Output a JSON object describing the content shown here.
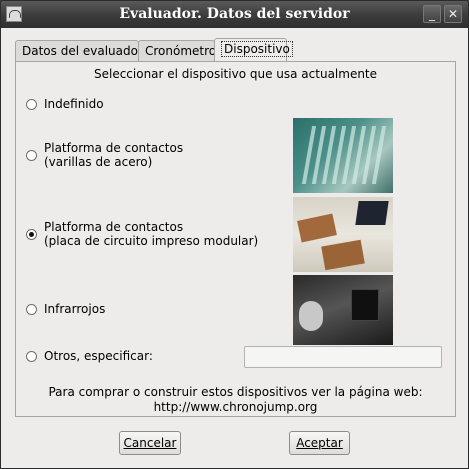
{
  "window": {
    "title": "Evaluador. Datos del servidor",
    "icons": {
      "app": "chronojump-app-icon",
      "minimize": "minimize-icon",
      "close": "close-icon"
    },
    "minimize_glyph": "_",
    "close_glyph": "✕"
  },
  "tabs": [
    {
      "label": "Datos del evaluador",
      "active": false
    },
    {
      "label": "Cronómetro",
      "active": false
    },
    {
      "label": "Dispositivo",
      "active": true
    }
  ],
  "panel": {
    "subtitle": "Seleccionar el dispositivo que usa actualmente",
    "options": [
      {
        "line1": "Indefinido",
        "line2": "",
        "checked": false,
        "photo": ""
      },
      {
        "line1": "Platforma de contactos",
        "line2": "(varillas de acero)",
        "checked": false,
        "photo": "contact-platform-steel-rods-photo"
      },
      {
        "line1": "Platforma de contactos",
        "line2": "(placa de circuito impreso modular)",
        "checked": true,
        "photo": "contact-platform-pcb-photo"
      },
      {
        "line1": "Infrarrojos",
        "line2": "",
        "checked": false,
        "photo": "infrared-device-photo"
      },
      {
        "line1": "Otros, especificar:",
        "line2": "",
        "checked": false,
        "photo": ""
      }
    ],
    "other_value": "",
    "footer_line1": "Para comprar o construir estos dispositivos ver la página web:",
    "footer_line2": "http://www.chronojump.org"
  },
  "buttons": {
    "cancel_label": "Cancelar",
    "accept_label": "Aceptar"
  }
}
